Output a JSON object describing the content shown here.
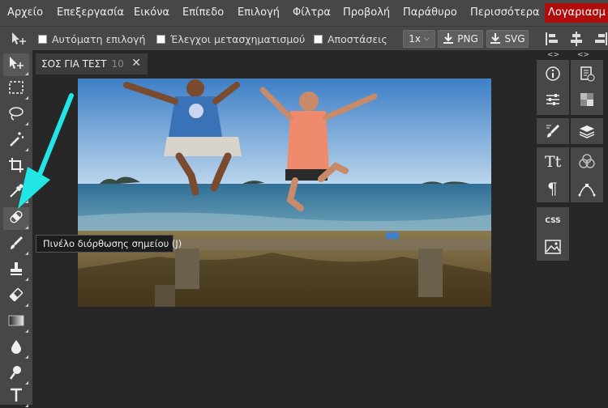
{
  "menu": {
    "items": [
      "Αρχείο",
      "Επεξεργασία",
      "Εικόνα",
      "Επίπεδο",
      "Επιλογή",
      "Φίλτρα",
      "Προβολή",
      "Παράθυρο",
      "Περισσότερα"
    ],
    "account": "Λογαριασμ"
  },
  "options": {
    "auto_select": "Αυτόματη επιλογή",
    "transform_controls": "Έλεγχοι μετασχηματισμού",
    "distances": "Αποστάσεις",
    "zoom": "1x",
    "png": "PNG",
    "svg": "SVG"
  },
  "tab": {
    "title": "ΣΟΣ ΓΙΑ ΤΕΣΤ",
    "suffix": "10"
  },
  "tooltip": {
    "text": "Πινέλο διόρθωσης σημείου (J)"
  },
  "panels": {
    "css_label": "CSS",
    "expander": "<>"
  },
  "colors": {
    "menubar": "#474747",
    "account": "#b00c0c",
    "background": "#272727",
    "annotation_arrow": "#22e5e5"
  },
  "icons": {
    "tools": [
      "move-icon",
      "marquee-icon",
      "lasso-icon",
      "magic-wand-icon",
      "crop-icon",
      "eyedropper-icon",
      "spot-healing-brush-icon",
      "brush-icon",
      "clone-stamp-icon",
      "eraser-icon",
      "gradient-icon",
      "blur-icon",
      "dodge-icon",
      "text-icon"
    ],
    "panels": [
      "info-icon",
      "history-icon",
      "adjustments-icon",
      "swatches-icon",
      "brush-settings-icon",
      "layers-icon",
      "character-icon",
      "channels-icon",
      "paragraph-icon",
      "paths-icon",
      "css-icon",
      "image-icon"
    ]
  }
}
